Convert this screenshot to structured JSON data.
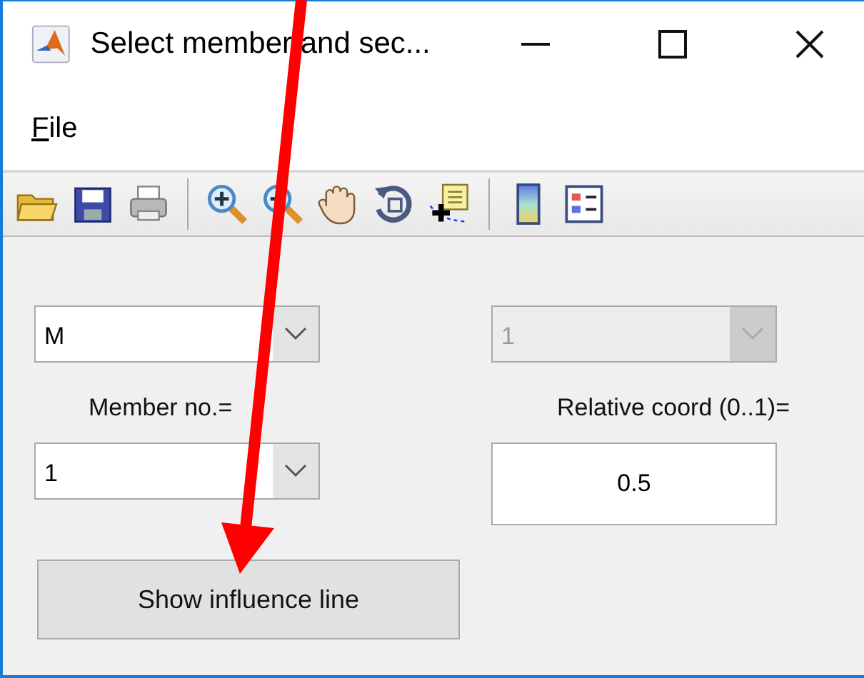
{
  "window": {
    "title": "Select member and sec..."
  },
  "menu": [
    {
      "label": "File"
    }
  ],
  "form": {
    "quantity_dropdown": {
      "value": "M",
      "disabled": false
    },
    "section_dropdown": {
      "value": "1",
      "disabled": true
    },
    "member_label": "Member no.=",
    "member_dropdown": {
      "value": "1",
      "disabled": false
    },
    "coord_label": "Relative coord (0..1)=",
    "coord_field": {
      "value": "0.5"
    },
    "button": "Show influence line"
  }
}
